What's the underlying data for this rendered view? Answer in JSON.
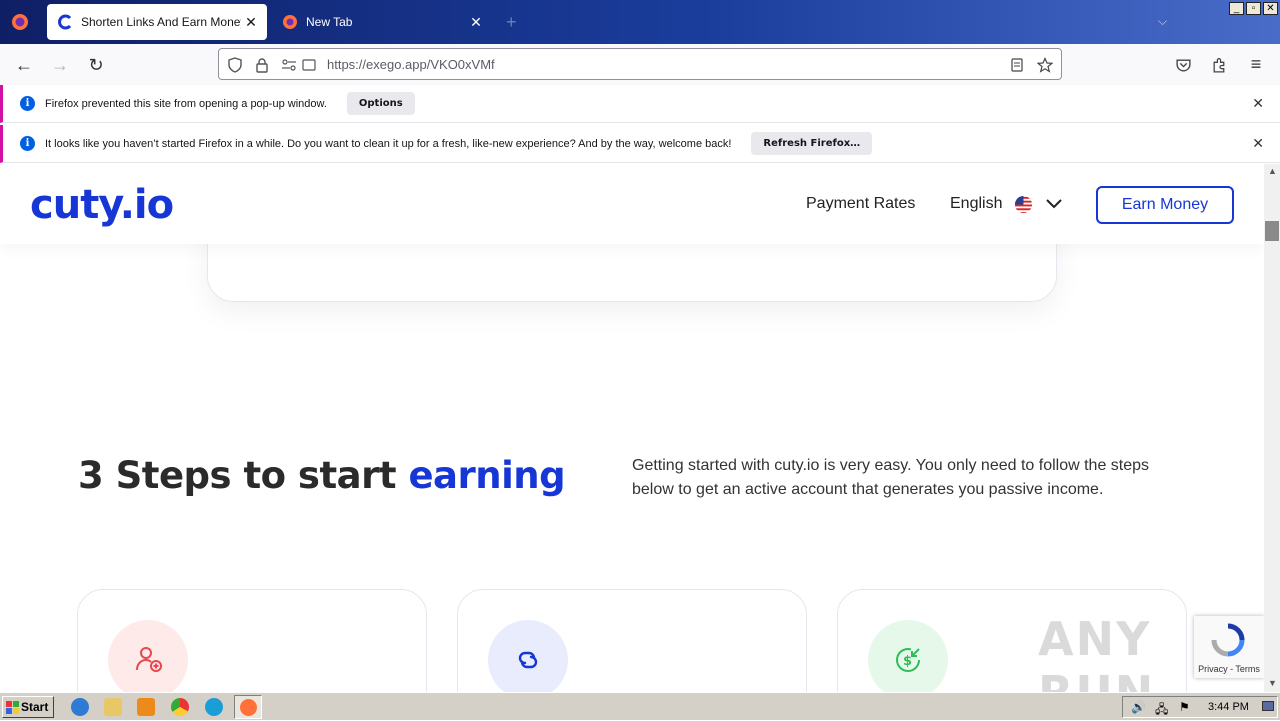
{
  "browser": {
    "tabs": [
      {
        "title": "Shorten Links And Earn Money | cu",
        "active": true
      },
      {
        "title": "New Tab",
        "active": false
      }
    ],
    "new_tab_symbol": "+",
    "close_symbol": "✕",
    "url": "https://exego.app/VKO0xVMf",
    "window_controls": [
      "_",
      "▫",
      "✕"
    ]
  },
  "notifications": [
    {
      "text": "Firefox prevented this site from opening a pop-up window.",
      "button": "Options"
    },
    {
      "text": "It looks like you haven’t started Firefox in a while. Do you want to clean it up for a fresh, like-new experience? And by the way, welcome back!",
      "button": "Refresh Firefox…"
    }
  ],
  "site": {
    "logo": "cuty.io",
    "nav": {
      "payment_rates": "Payment Rates",
      "language": "English"
    },
    "earn_button": "Earn Money",
    "steps_heading_prefix": "3 Steps to start ",
    "steps_heading_highlight": "earning",
    "intro": "Getting started with cuty.io is very easy. You only need to follow the steps below to get an active account that generates you passive income.",
    "steps": [
      {
        "icon": "add-user-icon",
        "bg": "#ffeaea",
        "color": "#e5484d"
      },
      {
        "icon": "link-icon",
        "bg": "#e8ecfd",
        "color": "#1736d6"
      },
      {
        "icon": "money-icon",
        "bg": "#e6f8ea",
        "color": "#2ebd59"
      }
    ],
    "accent": "#1736d6"
  },
  "recaptcha": {
    "text": "Privacy - Terms"
  },
  "watermark": "ANY RUN",
  "taskbar": {
    "start": "Start",
    "clock": "3:44 PM"
  }
}
